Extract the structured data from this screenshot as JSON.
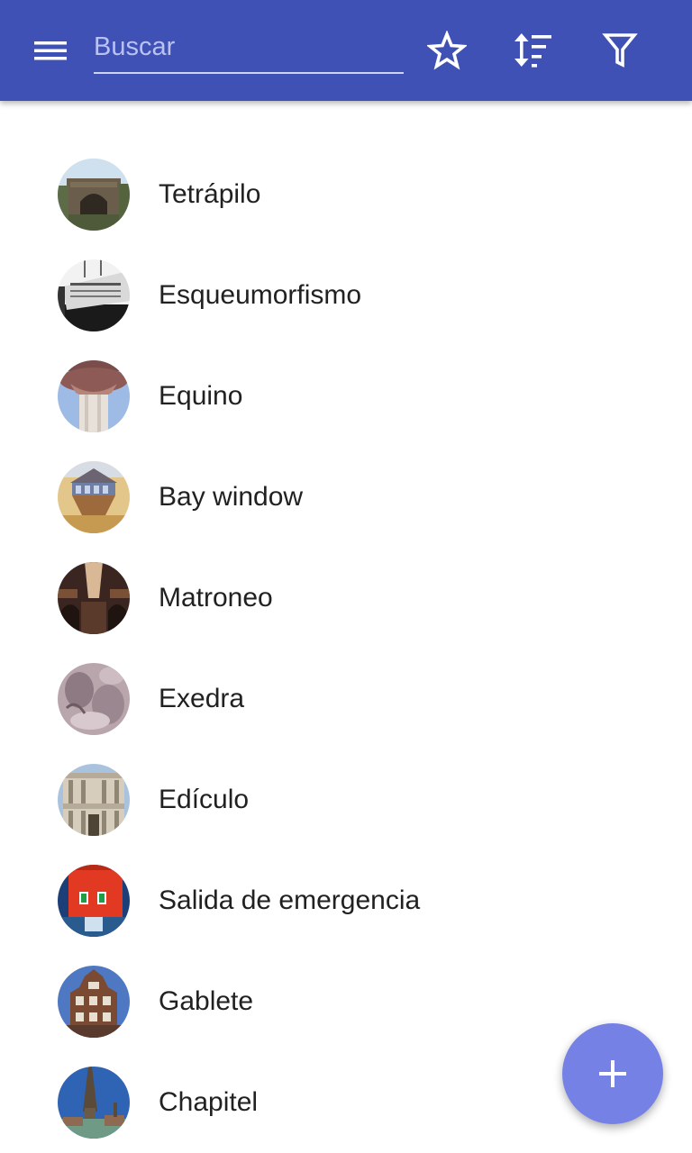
{
  "header": {
    "search_placeholder": "Buscar",
    "background_color": "#3f51b5",
    "icons": [
      "menu-icon",
      "star-icon",
      "sort-icon",
      "filter-icon"
    ]
  },
  "items": [
    {
      "label": "Tetrápilo",
      "thumbnail": "tetrapylon-photo"
    },
    {
      "label": "Esqueumorfismo",
      "thumbnail": "skeuomorphism-photo"
    },
    {
      "label": "Equino",
      "thumbnail": "echinus-photo"
    },
    {
      "label": "Bay window",
      "thumbnail": "bay-window-photo"
    },
    {
      "label": "Matroneo",
      "thumbnail": "matroneum-photo"
    },
    {
      "label": "Exedra",
      "thumbnail": "exedra-photo"
    },
    {
      "label": "Edículo",
      "thumbnail": "aedicula-photo"
    },
    {
      "label": "Salida de emergencia",
      "thumbnail": "emergency-exit-photo"
    },
    {
      "label": "Gablete",
      "thumbnail": "gablet-photo"
    },
    {
      "label": "Chapitel",
      "thumbnail": "spire-photo"
    }
  ],
  "fab": {
    "icon": "plus-icon",
    "color": "#7681e6"
  }
}
